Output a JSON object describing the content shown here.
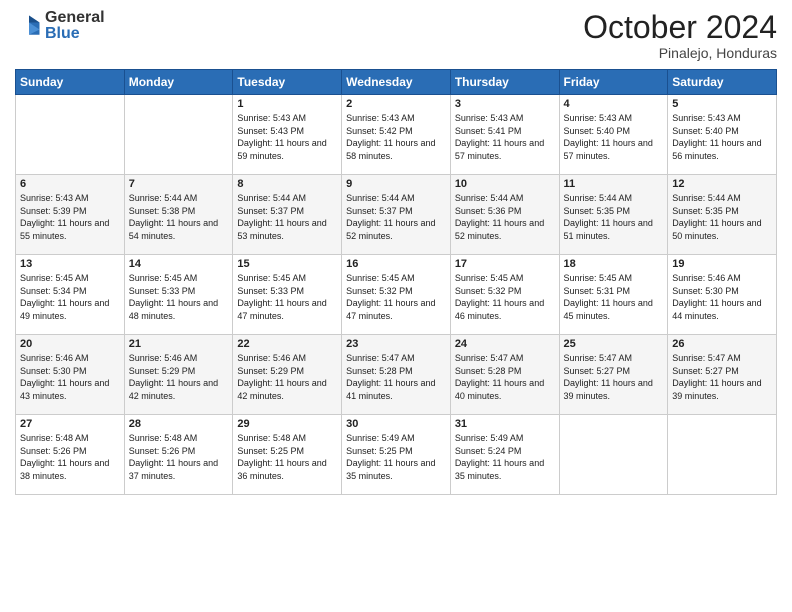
{
  "logo": {
    "general": "General",
    "blue": "Blue"
  },
  "title": "October 2024",
  "subtitle": "Pinalejo, Honduras",
  "days_of_week": [
    "Sunday",
    "Monday",
    "Tuesday",
    "Wednesday",
    "Thursday",
    "Friday",
    "Saturday"
  ],
  "weeks": [
    [
      {
        "day": "",
        "info": ""
      },
      {
        "day": "",
        "info": ""
      },
      {
        "day": "1",
        "info": "Sunrise: 5:43 AM\nSunset: 5:43 PM\nDaylight: 11 hours and 59 minutes."
      },
      {
        "day": "2",
        "info": "Sunrise: 5:43 AM\nSunset: 5:42 PM\nDaylight: 11 hours and 58 minutes."
      },
      {
        "day": "3",
        "info": "Sunrise: 5:43 AM\nSunset: 5:41 PM\nDaylight: 11 hours and 57 minutes."
      },
      {
        "day": "4",
        "info": "Sunrise: 5:43 AM\nSunset: 5:40 PM\nDaylight: 11 hours and 57 minutes."
      },
      {
        "day": "5",
        "info": "Sunrise: 5:43 AM\nSunset: 5:40 PM\nDaylight: 11 hours and 56 minutes."
      }
    ],
    [
      {
        "day": "6",
        "info": "Sunrise: 5:43 AM\nSunset: 5:39 PM\nDaylight: 11 hours and 55 minutes."
      },
      {
        "day": "7",
        "info": "Sunrise: 5:44 AM\nSunset: 5:38 PM\nDaylight: 11 hours and 54 minutes."
      },
      {
        "day": "8",
        "info": "Sunrise: 5:44 AM\nSunset: 5:37 PM\nDaylight: 11 hours and 53 minutes."
      },
      {
        "day": "9",
        "info": "Sunrise: 5:44 AM\nSunset: 5:37 PM\nDaylight: 11 hours and 52 minutes."
      },
      {
        "day": "10",
        "info": "Sunrise: 5:44 AM\nSunset: 5:36 PM\nDaylight: 11 hours and 52 minutes."
      },
      {
        "day": "11",
        "info": "Sunrise: 5:44 AM\nSunset: 5:35 PM\nDaylight: 11 hours and 51 minutes."
      },
      {
        "day": "12",
        "info": "Sunrise: 5:44 AM\nSunset: 5:35 PM\nDaylight: 11 hours and 50 minutes."
      }
    ],
    [
      {
        "day": "13",
        "info": "Sunrise: 5:45 AM\nSunset: 5:34 PM\nDaylight: 11 hours and 49 minutes."
      },
      {
        "day": "14",
        "info": "Sunrise: 5:45 AM\nSunset: 5:33 PM\nDaylight: 11 hours and 48 minutes."
      },
      {
        "day": "15",
        "info": "Sunrise: 5:45 AM\nSunset: 5:33 PM\nDaylight: 11 hours and 47 minutes."
      },
      {
        "day": "16",
        "info": "Sunrise: 5:45 AM\nSunset: 5:32 PM\nDaylight: 11 hours and 47 minutes."
      },
      {
        "day": "17",
        "info": "Sunrise: 5:45 AM\nSunset: 5:32 PM\nDaylight: 11 hours and 46 minutes."
      },
      {
        "day": "18",
        "info": "Sunrise: 5:45 AM\nSunset: 5:31 PM\nDaylight: 11 hours and 45 minutes."
      },
      {
        "day": "19",
        "info": "Sunrise: 5:46 AM\nSunset: 5:30 PM\nDaylight: 11 hours and 44 minutes."
      }
    ],
    [
      {
        "day": "20",
        "info": "Sunrise: 5:46 AM\nSunset: 5:30 PM\nDaylight: 11 hours and 43 minutes."
      },
      {
        "day": "21",
        "info": "Sunrise: 5:46 AM\nSunset: 5:29 PM\nDaylight: 11 hours and 42 minutes."
      },
      {
        "day": "22",
        "info": "Sunrise: 5:46 AM\nSunset: 5:29 PM\nDaylight: 11 hours and 42 minutes."
      },
      {
        "day": "23",
        "info": "Sunrise: 5:47 AM\nSunset: 5:28 PM\nDaylight: 11 hours and 41 minutes."
      },
      {
        "day": "24",
        "info": "Sunrise: 5:47 AM\nSunset: 5:28 PM\nDaylight: 11 hours and 40 minutes."
      },
      {
        "day": "25",
        "info": "Sunrise: 5:47 AM\nSunset: 5:27 PM\nDaylight: 11 hours and 39 minutes."
      },
      {
        "day": "26",
        "info": "Sunrise: 5:47 AM\nSunset: 5:27 PM\nDaylight: 11 hours and 39 minutes."
      }
    ],
    [
      {
        "day": "27",
        "info": "Sunrise: 5:48 AM\nSunset: 5:26 PM\nDaylight: 11 hours and 38 minutes."
      },
      {
        "day": "28",
        "info": "Sunrise: 5:48 AM\nSunset: 5:26 PM\nDaylight: 11 hours and 37 minutes."
      },
      {
        "day": "29",
        "info": "Sunrise: 5:48 AM\nSunset: 5:25 PM\nDaylight: 11 hours and 36 minutes."
      },
      {
        "day": "30",
        "info": "Sunrise: 5:49 AM\nSunset: 5:25 PM\nDaylight: 11 hours and 35 minutes."
      },
      {
        "day": "31",
        "info": "Sunrise: 5:49 AM\nSunset: 5:24 PM\nDaylight: 11 hours and 35 minutes."
      },
      {
        "day": "",
        "info": ""
      },
      {
        "day": "",
        "info": ""
      }
    ]
  ]
}
